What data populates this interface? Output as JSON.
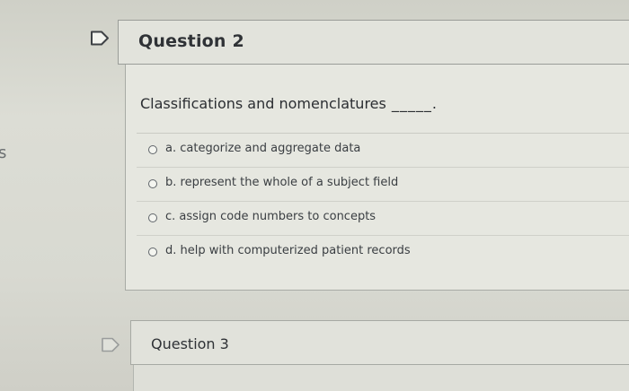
{
  "edge_glyph": "s",
  "question2": {
    "title": "Question 2",
    "text": "Classifications and nomenclatures",
    "blank": "_____.",
    "answers": [
      {
        "label": "a. categorize and aggregate data",
        "selected": false
      },
      {
        "label": "b. represent the whole of a subject field",
        "selected": false
      },
      {
        "label": "c. assign code numbers to concepts",
        "selected": false
      },
      {
        "label": "d. help with computerized patient records",
        "selected": false
      }
    ]
  },
  "question3": {
    "title": "Question 3"
  },
  "icons": {
    "flag": "flag-outline-icon"
  }
}
